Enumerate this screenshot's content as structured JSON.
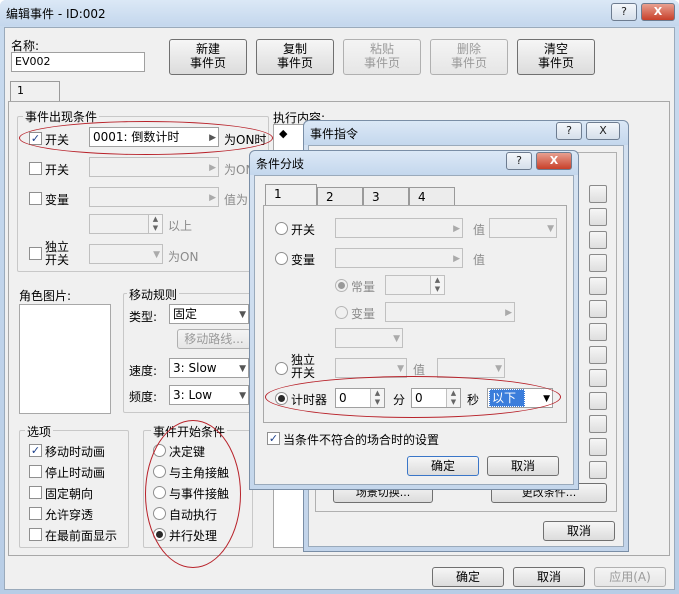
{
  "main": {
    "title": "编辑事件 - ID:002",
    "help_btn": "?",
    "close_btn": "X",
    "name_label": "名称:",
    "name_value": "EV002",
    "toolbar": [
      {
        "line1": "新建",
        "line2": "事件页",
        "enabled": true
      },
      {
        "line1": "复制",
        "line2": "事件页",
        "enabled": true
      },
      {
        "line1": "粘贴",
        "line2": "事件页",
        "enabled": false
      },
      {
        "line1": "删除",
        "line2": "事件页",
        "enabled": false
      },
      {
        "line1": "清空",
        "line2": "事件页",
        "enabled": true
      }
    ],
    "page_tab": "1",
    "cond": {
      "group": "事件出现条件",
      "switch1_label": "开关",
      "switch1_value": "0001: 倒数计时",
      "switch1_suffix": "为ON时",
      "switch2_label": "开关",
      "switch2_suffix": "为ON",
      "var_label": "变量",
      "var_suffix": "值为",
      "above": "以上",
      "self_line1": "独立",
      "self_line2": "开关",
      "self_suffix": "为ON"
    },
    "exec_label": "执行内容:",
    "exec_bullet": "◆",
    "char_image": "角色图片:",
    "move": {
      "group": "移动规则",
      "type_label": "类型:",
      "type_value": "固定",
      "route_btn": "移动路线...",
      "speed_label": "速度:",
      "speed_value": "3: Slow",
      "freq_label": "频度:",
      "freq_value": "3: Low"
    },
    "options": {
      "group": "选项",
      "items": [
        {
          "label": "移动时动画",
          "checked": true
        },
        {
          "label": "停止时动画",
          "checked": false
        },
        {
          "label": "固定朝向",
          "checked": false
        },
        {
          "label": "允许穿透",
          "checked": false
        },
        {
          "label": "在最前面显示",
          "checked": false
        }
      ]
    },
    "trigger": {
      "group": "事件开始条件",
      "items": [
        {
          "label": "决定键",
          "selected": false
        },
        {
          "label": "与主角接触",
          "selected": false
        },
        {
          "label": "与事件接触",
          "selected": false
        },
        {
          "label": "自动执行",
          "selected": false
        },
        {
          "label": "并行处理",
          "selected": true
        }
      ]
    },
    "ok": "确定",
    "cancel": "取消",
    "apply": "应用(A)"
  },
  "cmd": {
    "title": "事件指令",
    "help_btn": "?",
    "close_btn": "X",
    "partial_btn_left": "场景切换...",
    "partial_btn_right": "更改条件...",
    "cancel": "取消"
  },
  "cond_dialog": {
    "title": "条件分歧",
    "help_btn": "?",
    "close_btn": "X",
    "tabs": [
      "1",
      "2",
      "3",
      "4"
    ],
    "switch_label": "开关",
    "value_label": "值",
    "var_label": "变量",
    "const_label": "常量",
    "variable_label": "变量",
    "self_line1": "独立",
    "self_line2": "开关",
    "timer_label": "计时器",
    "timer_min": "0",
    "min_unit": "分",
    "timer_sec": "0",
    "sec_unit": "秒",
    "timer_cmp": "以下",
    "else_label": "当条件不符合的场合时的设置",
    "ok": "确定",
    "cancel": "取消"
  }
}
